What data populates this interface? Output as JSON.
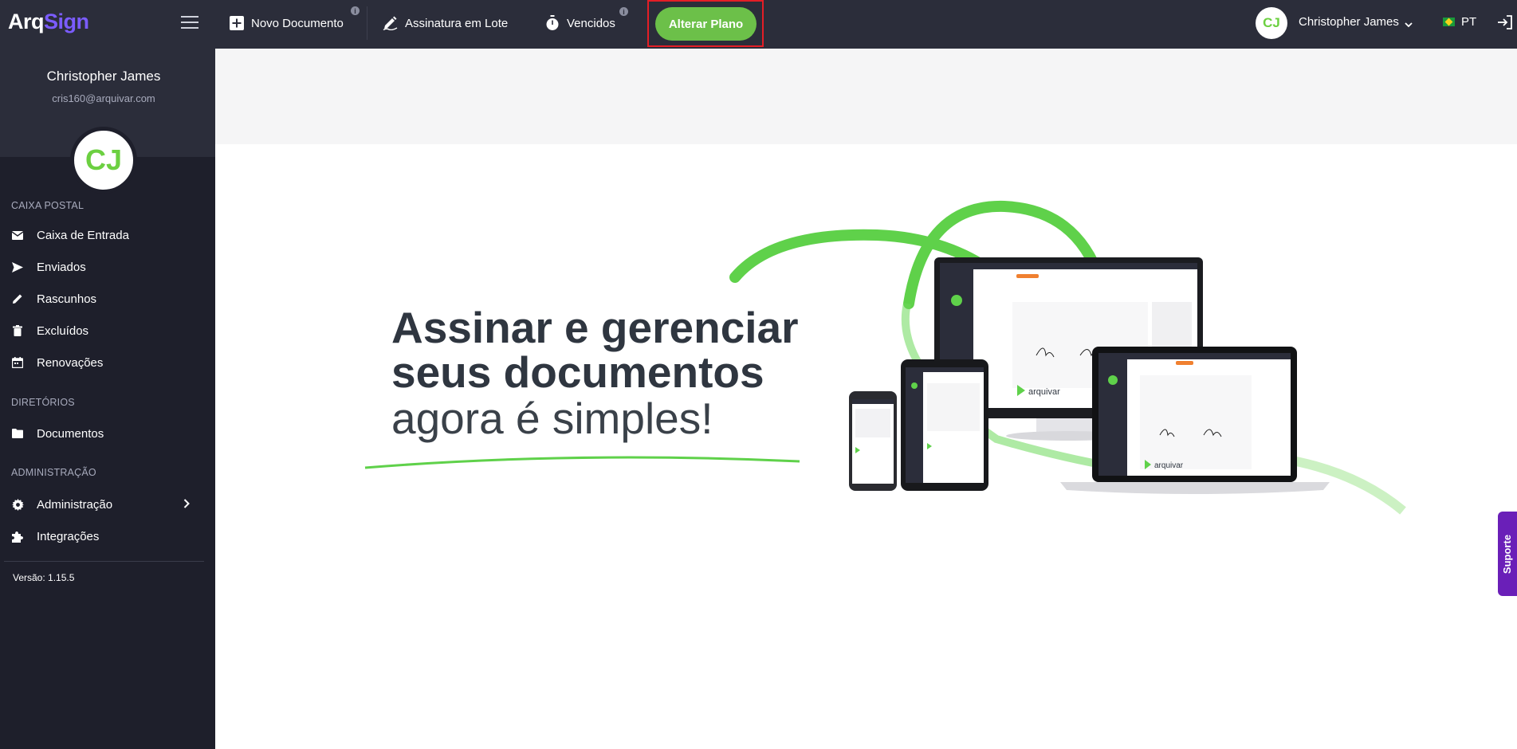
{
  "app": {
    "logo_main": "Arq",
    "logo_accent": "Sign"
  },
  "sidebar": {
    "profile": {
      "name": "Christopher James",
      "email": "cris160@arquivar.com",
      "initials": "CJ"
    },
    "sections": [
      {
        "title": "CAIXA POSTAL",
        "items": [
          {
            "label": "Caixa de Entrada",
            "icon": "envelope-icon"
          },
          {
            "label": "Enviados",
            "icon": "send-icon"
          },
          {
            "label": "Rascunhos",
            "icon": "pencil-icon"
          },
          {
            "label": "Excluídos",
            "icon": "trash-icon"
          },
          {
            "label": "Renovações",
            "icon": "calendar-icon"
          }
        ]
      },
      {
        "title": "DIRETÓRIOS",
        "items": [
          {
            "label": "Documentos",
            "icon": "folder-icon"
          }
        ]
      },
      {
        "title": "ADMINISTRAÇÃO",
        "items": [
          {
            "label": "Administração",
            "icon": "gear-icon"
          },
          {
            "label": "Integrações",
            "icon": "puzzle-icon"
          }
        ]
      }
    ],
    "version": "Versão: 1.15.5"
  },
  "topbar": {
    "new_document": "Novo Documento",
    "batch_signature": "Assinatura em Lote",
    "expired": "Vencidos",
    "change_plan": "Alterar Plano",
    "user_initials": "CJ",
    "user_name": "Christopher James",
    "language": "PT",
    "info_glyph": "i"
  },
  "hero": {
    "line1": "Assinar e gerenciar",
    "line2": "seus documentos",
    "line3": "agora é simples!",
    "brand_name": "arquivar"
  },
  "support": {
    "label": "Suporte"
  },
  "colors": {
    "accent_green": "#6cc049",
    "accent_purple": "#7b5cff",
    "sidebar_bg": "#1e1f2b",
    "topbar_bg": "#2b2d3a",
    "highlight_border": "#e41e26",
    "support_purple": "#6a1fb8"
  }
}
